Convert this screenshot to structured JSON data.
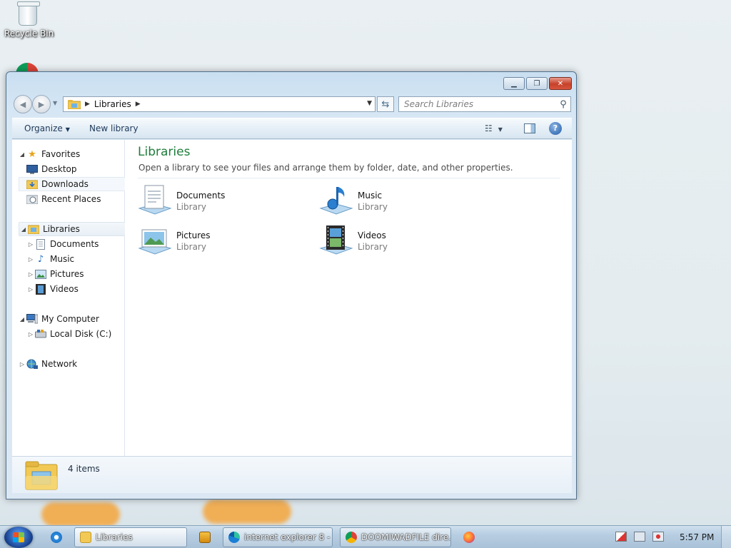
{
  "desktop": {
    "recycle_bin_label": "Recycle Bin"
  },
  "window": {
    "address": {
      "crumbs": [
        "Libraries"
      ]
    },
    "search": {
      "placeholder": "Search Libraries"
    },
    "toolbar": {
      "organize_label": "Organize",
      "new_library_label": "New library",
      "help_symbol": "?"
    },
    "nav_pane": {
      "favorites": {
        "label": "Favorites",
        "items": [
          "Desktop",
          "Downloads",
          "Recent Places"
        ]
      },
      "libraries": {
        "label": "Libraries",
        "items": [
          "Documents",
          "Music",
          "Pictures",
          "Videos"
        ]
      },
      "computer": {
        "label": "My Computer",
        "items": [
          "Local Disk (C:)"
        ]
      },
      "network": {
        "label": "Network"
      }
    },
    "content": {
      "heading": "Libraries",
      "subtitle": "Open a library to see your files and arrange them by folder, date, and other properties.",
      "libraries": [
        {
          "name": "Documents",
          "type": "Library",
          "icon": "documents-library-icon"
        },
        {
          "name": "Music",
          "type": "Library",
          "icon": "music-library-icon"
        },
        {
          "name": "Pictures",
          "type": "Library",
          "icon": "pictures-library-icon"
        },
        {
          "name": "Videos",
          "type": "Library",
          "icon": "videos-library-icon"
        }
      ]
    },
    "status": {
      "item_count": "4 items"
    }
  },
  "taskbar": {
    "buttons": [
      {
        "label": "Libraries",
        "icon": "libraries-folder-icon",
        "active": true
      },
      {
        "label": "internet explorer 8 - ...",
        "icon": "edge-icon"
      },
      {
        "label": "DOOMIWADFILE dire...",
        "icon": "chrome-icon"
      }
    ],
    "clock": "5:57 PM"
  },
  "colors": {
    "heading_green": "#1e7d3a",
    "toolbar_text": "#1e395b",
    "close_red": "#c6412a"
  }
}
